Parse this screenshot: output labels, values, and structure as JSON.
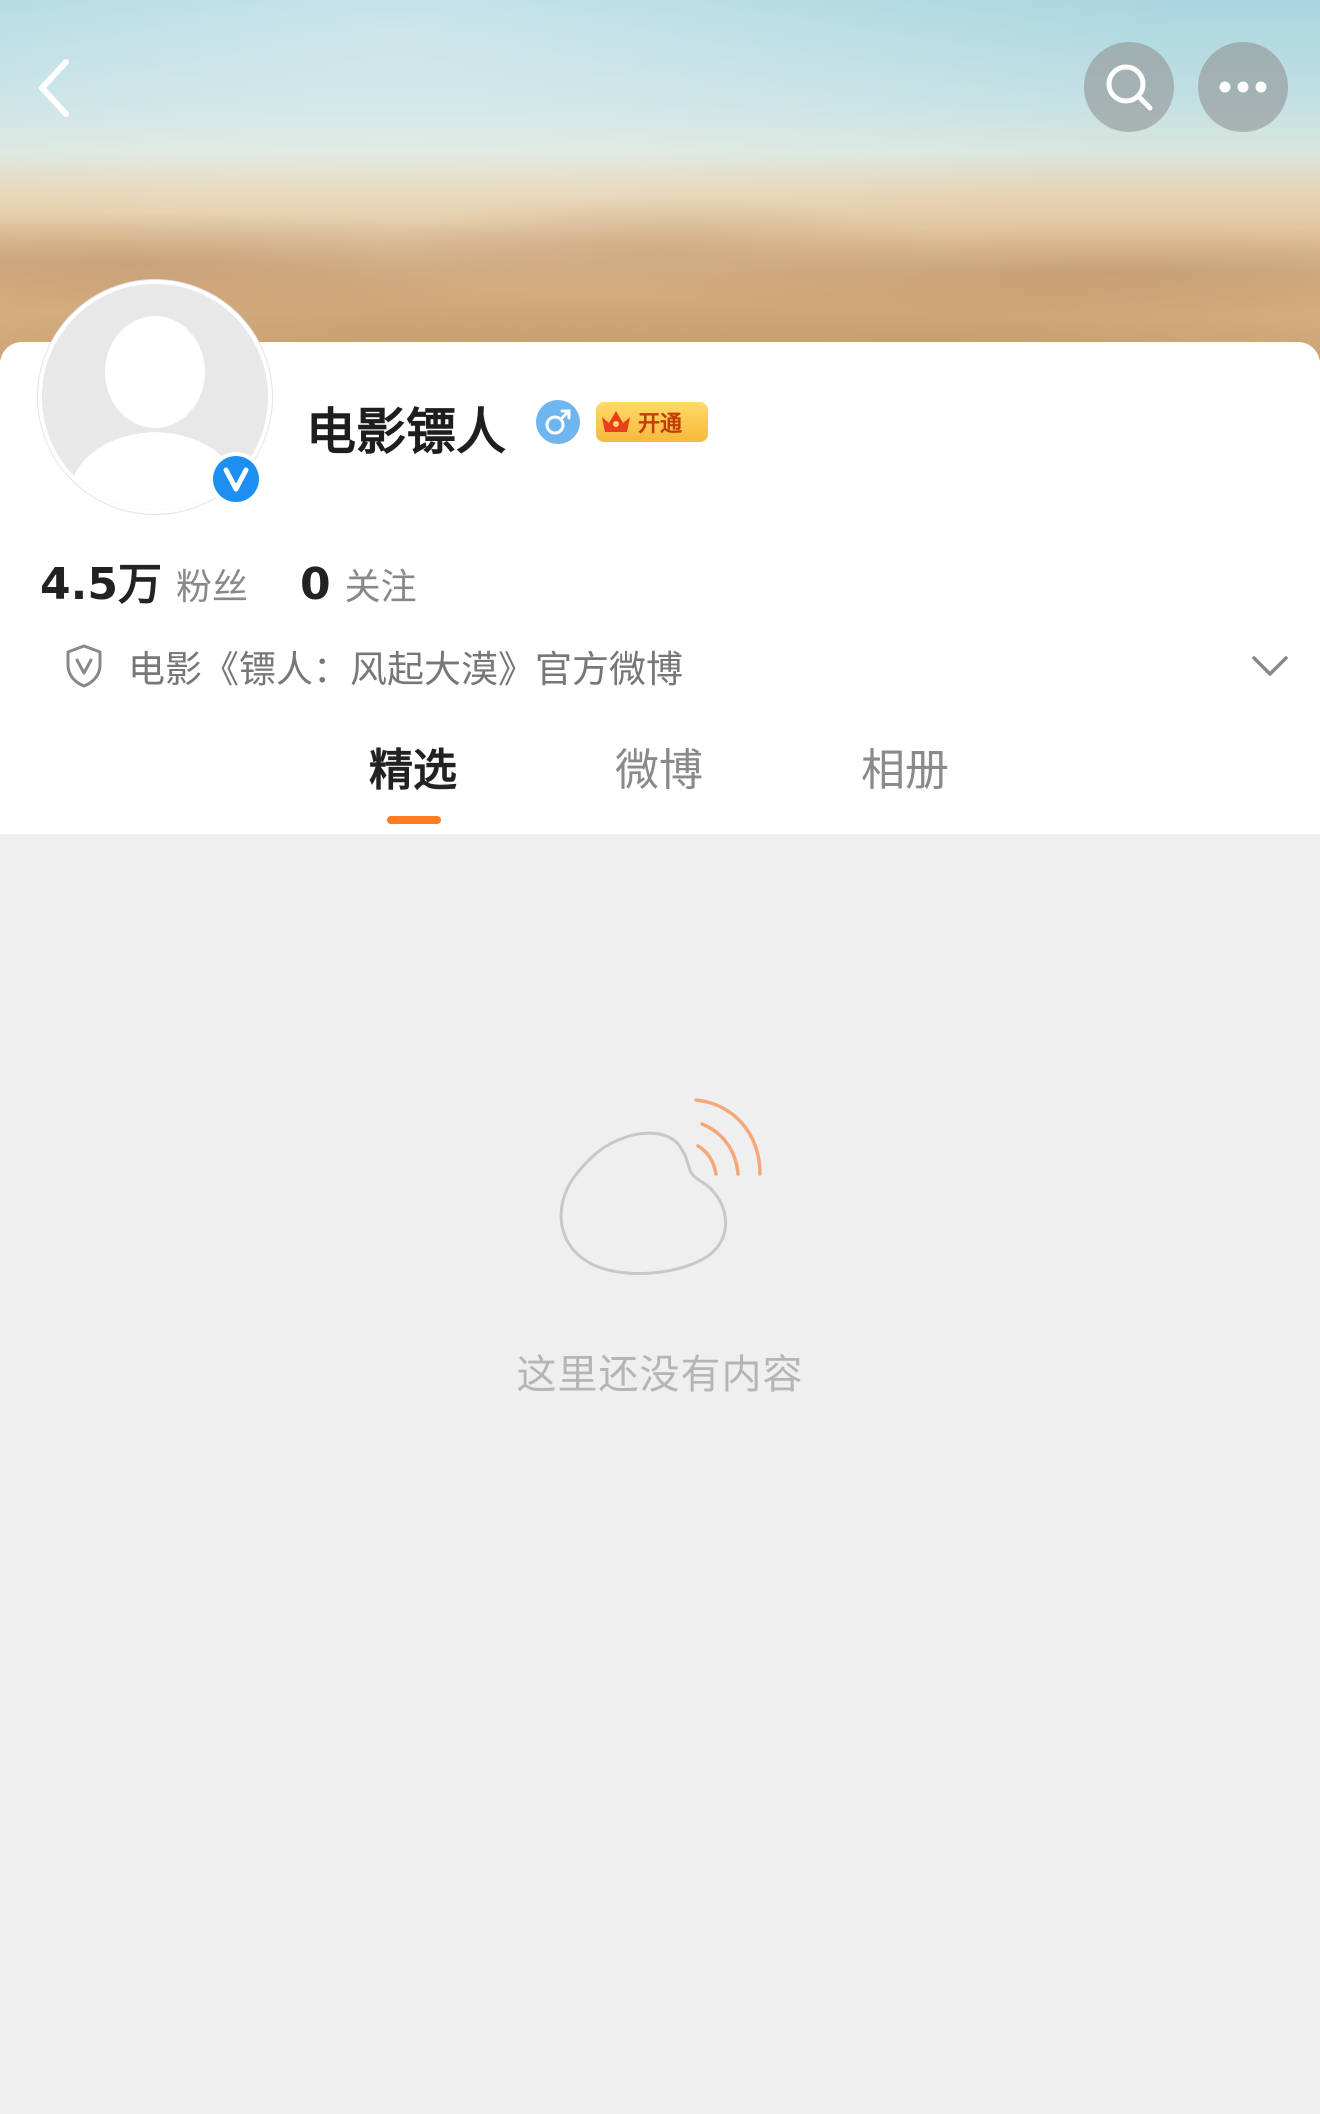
{
  "header": {
    "back_icon": "chevron-left-icon",
    "search_icon": "search-icon",
    "more_icon": "more-dots-icon"
  },
  "profile": {
    "name": "电影镖人",
    "gender_icon": "male-icon",
    "verified_icon": "verified-v-icon",
    "vip_label": "开通",
    "stats": {
      "followers_count": "4.5万",
      "followers_label": "粉丝",
      "following_count": "0",
      "following_label": "关注"
    },
    "description": "电影《镖人：风起大漠》官方微博"
  },
  "tabs": [
    {
      "label": "精选",
      "active": true
    },
    {
      "label": "微博",
      "active": false
    },
    {
      "label": "相册",
      "active": false
    }
  ],
  "empty_state": {
    "message": "这里还没有内容"
  },
  "colors": {
    "accent": "#ff7b1f",
    "verified_blue": "#1d8ff0",
    "background": "#efefef"
  }
}
